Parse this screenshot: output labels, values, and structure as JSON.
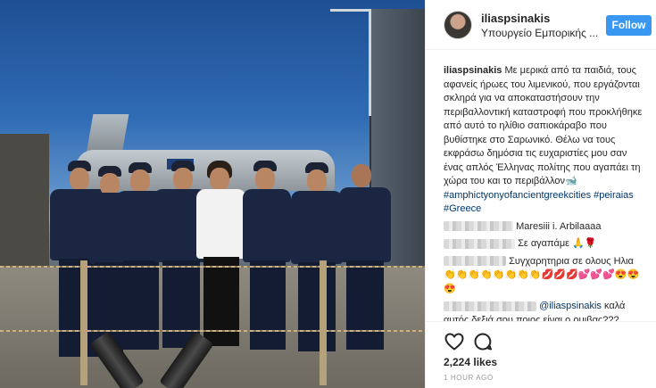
{
  "post": {
    "username": "iliaspsinakis",
    "location": "Υπουργείο Εμπορικής ...",
    "follow_label": "Follow",
    "caption_user": "iliaspsinakis",
    "caption_text": "Με μερικά από τα παιδιά, τους αφανείς ήρωες του λιμενικού, που εργάζονται σκληρά για να αποκαταστήσουν την περιβαλλοντική καταστροφή που προκλήθηκε από αυτό το ηλίθιο σαπιοκάραβο που βυθίστηκε στο Σαρωνικό. Θέλω να τους εκφράσω δημόσια τις ευχαριστίες μου σαν ένας απλός Έλληνας πολίτης που αγαπάει τη χώρα του και το περιβάλλον🐋",
    "hashtags": [
      "#amphictyonyofancientgreekcities",
      "#peiraias",
      "#Greece"
    ],
    "likes": "2,224 likes",
    "timestamp": "1 hour ago"
  },
  "comments": [
    {
      "text": "Maresiii i. Arbilaaaa"
    },
    {
      "text": "Σε αγαπάμε 🙏🌹"
    },
    {
      "text": "Συγχαρητηρια σε ολους Ηλια👏👏👏👏👏👏👏👏💋💋💋💕💕💕😍😍😍"
    },
    {
      "mention": "@iliaspsinakis",
      "text": " καλά αυτός δεξιά σου ποιος είναι ο ομιβας???"
    }
  ],
  "icons": {
    "like": "heart-icon",
    "comment": "comment-bubble-icon"
  },
  "colors": {
    "follow_button": "#3897f0",
    "hashtag": "#003569",
    "timestamp": "#999999"
  }
}
